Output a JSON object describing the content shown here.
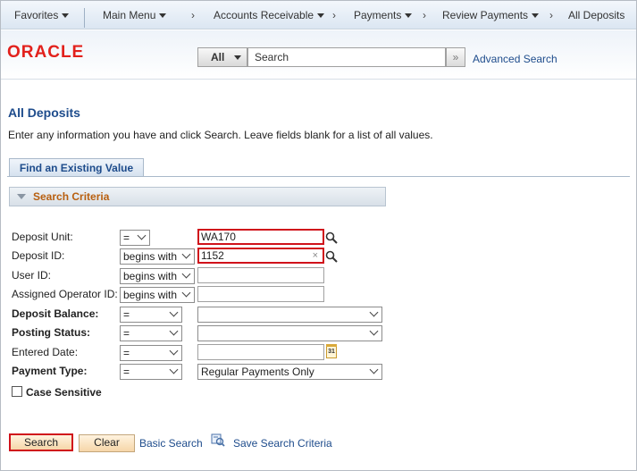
{
  "nav": {
    "favorites": "Favorites",
    "main_menu": "Main Menu",
    "breadcrumb": [
      "Accounts Receivable",
      "Payments",
      "Review Payments",
      "All Deposits"
    ]
  },
  "header": {
    "logo": "ORACLE",
    "scope_label": "All",
    "search_placeholder": "Search",
    "advanced_search": "Advanced Search"
  },
  "page": {
    "title": "All Deposits",
    "instructions": "Enter any information you have and click Search. Leave fields blank for a list of all values.",
    "tab": "Find an Existing Value",
    "section": "Search Criteria"
  },
  "criteria": [
    {
      "label": "Deposit Unit:",
      "operator": "=",
      "value": "WA170"
    },
    {
      "label": "Deposit ID:",
      "operator": "begins with",
      "value": "1152",
      "clear": "×"
    },
    {
      "label": "User ID:",
      "operator": "begins with",
      "value": ""
    },
    {
      "label": "Assigned Operator ID:",
      "operator": "begins with",
      "value": ""
    },
    {
      "label": "Deposit Balance:",
      "operator": "=",
      "value": ""
    },
    {
      "label": "Posting Status:",
      "operator": "=",
      "value": ""
    },
    {
      "label": "Entered Date:",
      "operator": "=",
      "value": "",
      "calendar": "31"
    },
    {
      "label": "Payment Type:",
      "operator": "=",
      "value": "Regular Payments Only"
    }
  ],
  "case_sensitive": "Case Sensitive",
  "actions": {
    "search": "Search",
    "clear": "Clear",
    "basic_search": "Basic Search",
    "save_search": "Save Search Criteria"
  }
}
